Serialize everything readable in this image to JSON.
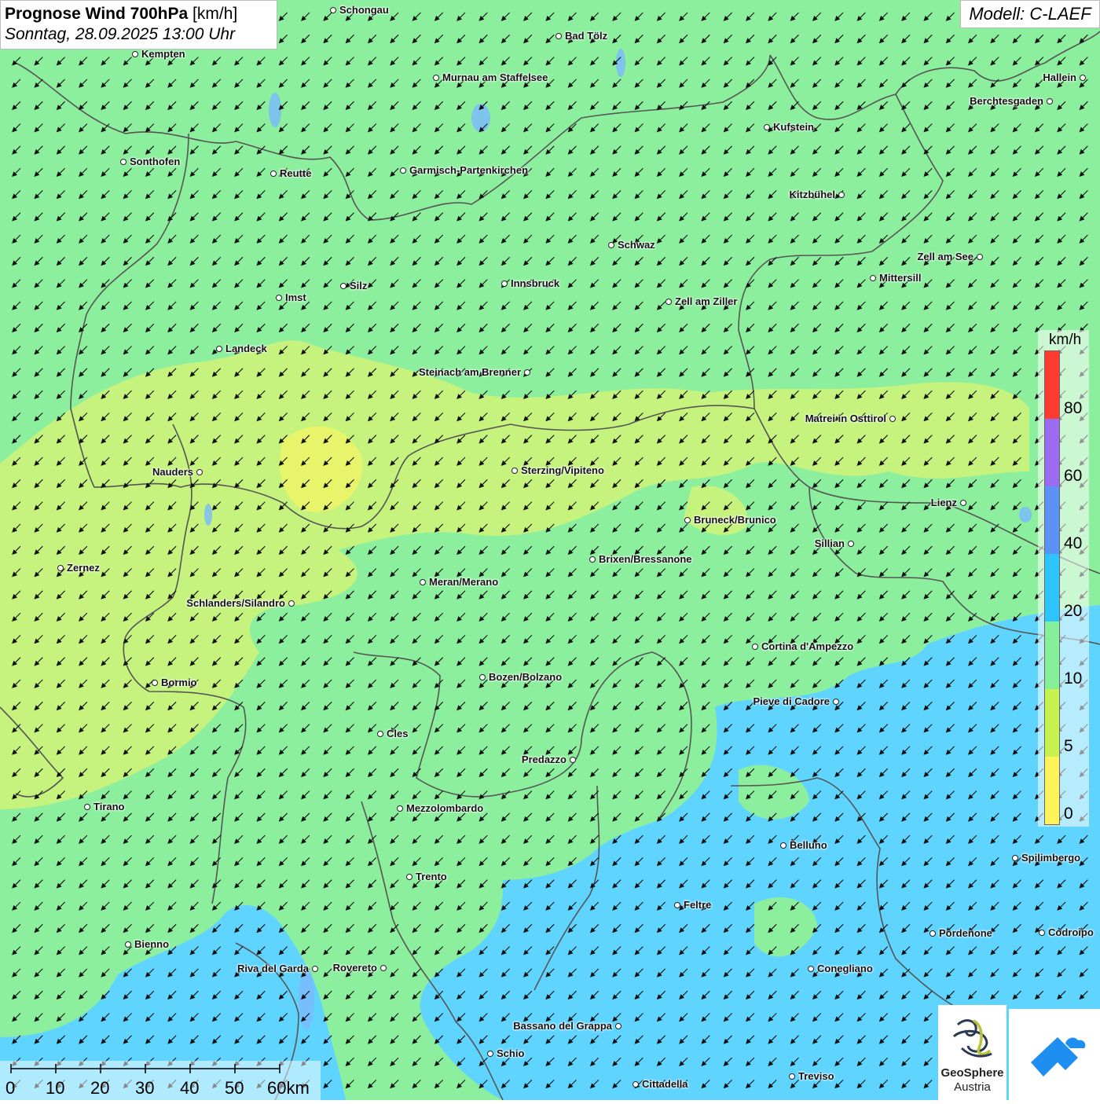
{
  "title": {
    "bold": "Prognose Wind 700hPa",
    "unit": "[km/h]",
    "datetime": "Sonntag, 28.09.2025 13:00 Uhr"
  },
  "model": "Modell: C-LAEF",
  "legend": {
    "unit": "km/h",
    "labels": [
      "80",
      "60",
      "40",
      "20",
      "10",
      "5",
      "0"
    ],
    "colors": [
      "#ff3b30",
      "#9b6cf0",
      "#5b93f5",
      "#2ec5ff",
      "#86ef9a",
      "#c8f24f",
      "#fff25a"
    ]
  },
  "cities": [
    {
      "name": "Schongau"
    },
    {
      "name": "Bad Tölz"
    },
    {
      "name": "Kempten"
    },
    {
      "name": "Murnau am Staffelsee"
    },
    {
      "name": "Hallein"
    },
    {
      "name": "Berchtesgaden"
    },
    {
      "name": "Kufstein"
    },
    {
      "name": "Sonthofen"
    },
    {
      "name": "Reutte"
    },
    {
      "name": "Garmisch-Partenkirchen"
    },
    {
      "name": "Kitzbühel"
    },
    {
      "name": "Schwaz"
    },
    {
      "name": "Zell am See"
    },
    {
      "name": "Mittersill"
    },
    {
      "name": "Innsbruck"
    },
    {
      "name": "Silz"
    },
    {
      "name": "Imst"
    },
    {
      "name": "Zell am Ziller"
    },
    {
      "name": "Landeck"
    },
    {
      "name": "Steinach am Brenner"
    },
    {
      "name": "Matrei in Osttirol"
    },
    {
      "name": "Nauders"
    },
    {
      "name": "Sterzing/Vipiteno"
    },
    {
      "name": "Lienz"
    },
    {
      "name": "Bruneck/Brunico"
    },
    {
      "name": "Sillian"
    },
    {
      "name": "Brixen/Bressanone"
    },
    {
      "name": "Zernez"
    },
    {
      "name": "Meran/Merano"
    },
    {
      "name": "Schlanders/Silandro"
    },
    {
      "name": "Cortina d'Ampezzo"
    },
    {
      "name": "Bozen/Bolzano"
    },
    {
      "name": "Bormio"
    },
    {
      "name": "Pieve di Cadore"
    },
    {
      "name": "Cles"
    },
    {
      "name": "Predazzo"
    },
    {
      "name": "Tirano"
    },
    {
      "name": "Mezzolombardo"
    },
    {
      "name": "Belluno"
    },
    {
      "name": "Spilimbergo"
    },
    {
      "name": "Trento"
    },
    {
      "name": "Feltre"
    },
    {
      "name": "Pordenone"
    },
    {
      "name": "Codroipo"
    },
    {
      "name": "Bienno"
    },
    {
      "name": "Riva del Garda"
    },
    {
      "name": "Rovereto"
    },
    {
      "name": "Conegliano"
    },
    {
      "name": "Bassano del Grappa"
    },
    {
      "name": "Schio"
    },
    {
      "name": "Treviso"
    },
    {
      "name": "Cittadella"
    }
  ],
  "scale": {
    "labels": [
      "0",
      "10",
      "20",
      "30",
      "40",
      "50",
      "60km"
    ]
  },
  "logo": {
    "line1": "GeoSphere",
    "line2": "Austria"
  },
  "colors": {
    "green": "#8bf09c",
    "yellow_green": "#c8f07a",
    "blue": "#5fd4ff",
    "border": "#555555"
  }
}
